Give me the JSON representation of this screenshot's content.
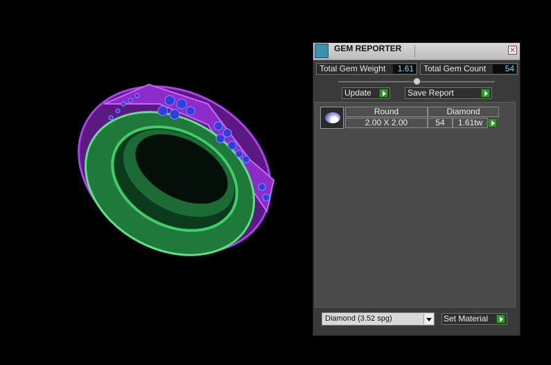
{
  "viewport": {
    "ring_colors": {
      "shank": "#2fb85a",
      "bezel": "#9b2fd6",
      "gems": "#2a3bd0"
    }
  },
  "panel": {
    "title": "GEM REPORTER",
    "icon": "gem-reporter-icon",
    "close_label": "×",
    "total_weight_label": "Total Gem Weight",
    "total_weight_value": "1.61",
    "total_count_label": "Total Gem Count",
    "total_count_value": "54",
    "update_label": "Update",
    "save_report_label": "Save Report",
    "gems": [
      {
        "shape": "Round",
        "material": "Diamond",
        "size": "2.00 X 2.00",
        "count": "54",
        "weight": "1.61tw"
      }
    ],
    "material_select_value": "Diamond     (3.52 spg)",
    "set_material_label": "Set Material"
  }
}
